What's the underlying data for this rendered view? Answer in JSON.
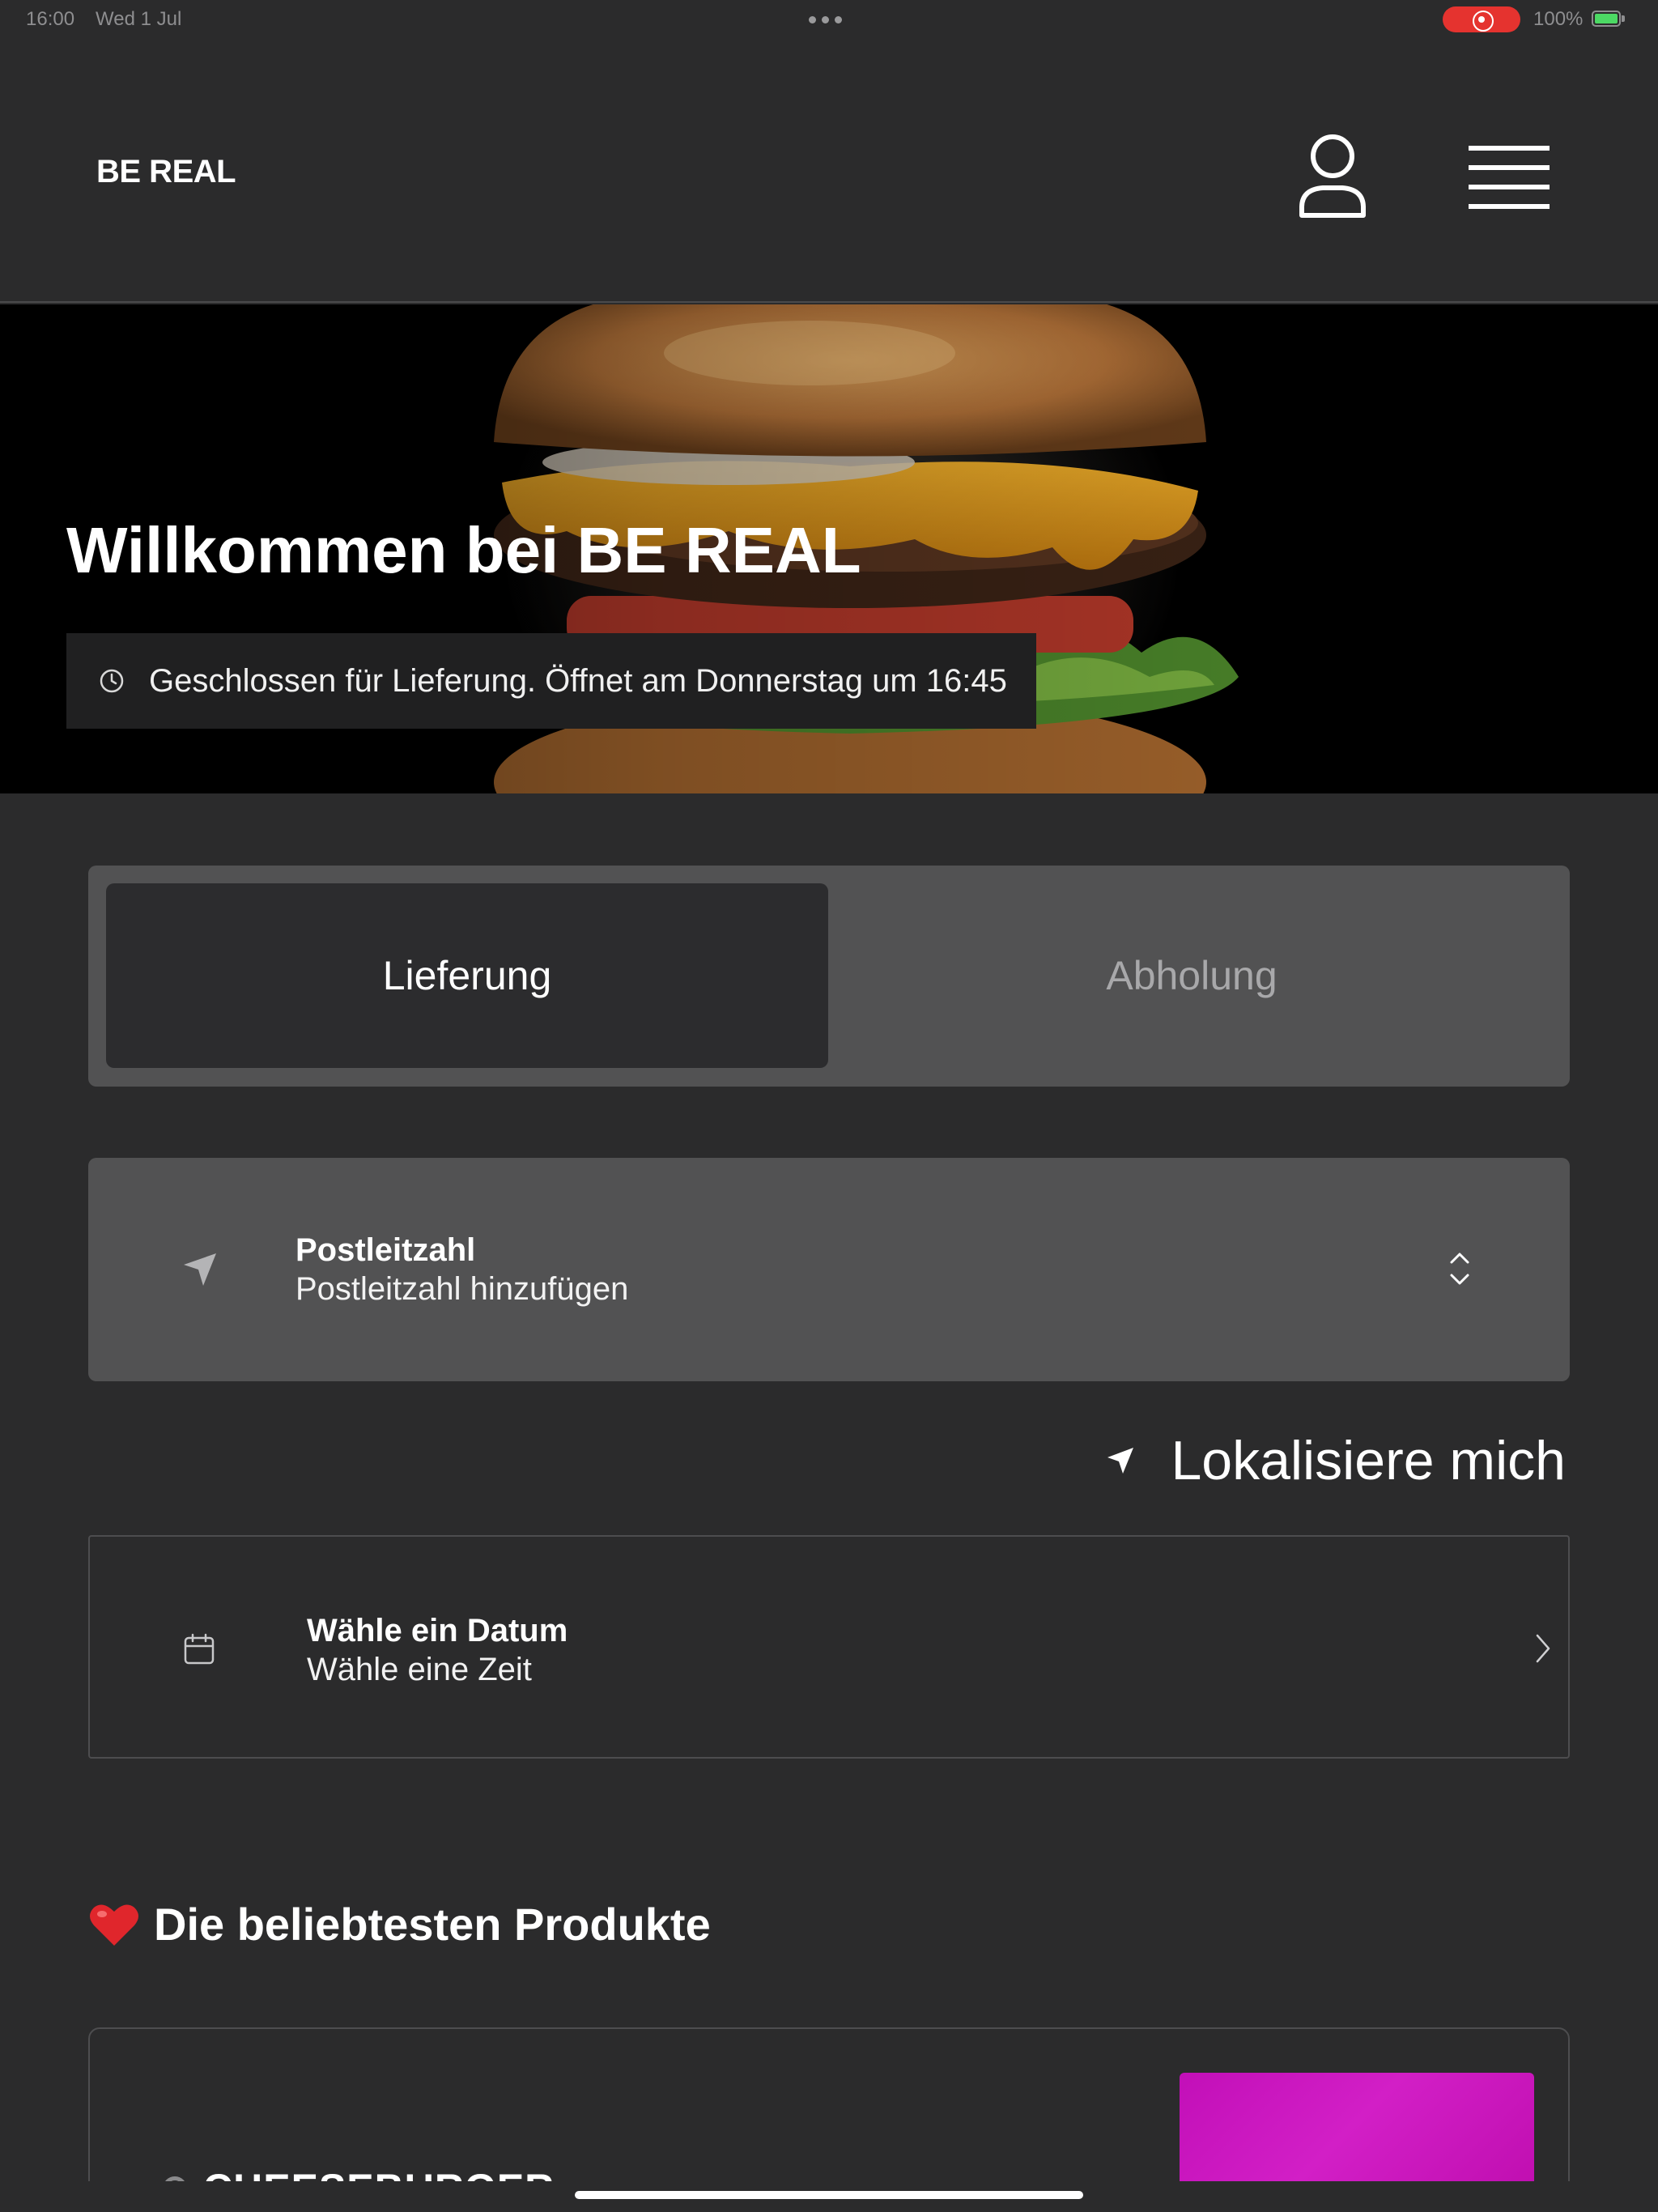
{
  "status_bar": {
    "time": "16:00",
    "date": "Wed 1 Jul",
    "battery_percent": "100%",
    "recording_indicator_color": "#e5332f",
    "battery_charging_color": "#4cd964"
  },
  "header": {
    "brand": "BE REAL",
    "profile_icon": "user-icon",
    "menu_icon": "hamburger-menu-icon"
  },
  "hero": {
    "image": "burger-photo",
    "title": "Willkommen bei BE REAL",
    "hours_icon": "clock-icon",
    "hours_text": "Geschlossen für Lieferung. Öffnet am Donnerstag um 16:45"
  },
  "order_mode": {
    "tabs": [
      {
        "label": "Lieferung",
        "selected": true
      },
      {
        "label": "Abholung",
        "selected": false
      }
    ]
  },
  "postcode": {
    "icon": "location-arrow-icon",
    "title": "Postleitzahl",
    "placeholder": "Postleitzahl hinzufügen",
    "toggle_icon": "chevron-up-down-icon"
  },
  "localize": {
    "icon": "location-arrow-icon",
    "label": "Lokalisiere mich"
  },
  "schedule": {
    "icon": "calendar-icon",
    "title": "Wähle ein Datum",
    "subtitle": "Wähle eine Zeit",
    "chevron_icon": "chevron-right-icon"
  },
  "popular": {
    "icon": "heart-icon",
    "title": "Die beliebtesten Produkte",
    "products": [
      {
        "name": "CHEESEBURGER",
        "image_color": "#c90fbd"
      }
    ]
  },
  "colors": {
    "background": "#2b2b2c",
    "panel": "#525253",
    "active_tab": "#2c2c2e",
    "inactive_tab_text": "#a8a8aa"
  }
}
